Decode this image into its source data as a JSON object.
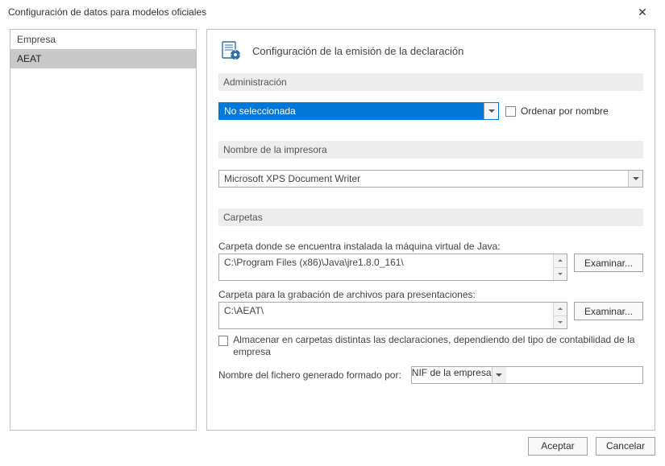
{
  "titlebar": {
    "title": "Configuración de datos para modelos oficiales"
  },
  "sidebar": {
    "items": [
      {
        "label": "Empresa",
        "selected": false
      },
      {
        "label": "AEAT",
        "selected": true
      }
    ]
  },
  "panel": {
    "title": "Configuración de la emisión de la declaración",
    "sections": {
      "admin": {
        "label": "Administración",
        "selected": "No seleccionada",
        "sort_label": "Ordenar por nombre",
        "sort_checked": false
      },
      "printer": {
        "label": "Nombre de la impresora",
        "value": "Microsoft XPS Document Writer"
      },
      "folders": {
        "label": "Carpetas",
        "java": {
          "label": "Carpeta donde se encuentra instalada la máquina virtual de Java:",
          "value": "C:\\Program Files (x86)\\Java\\jre1.8.0_161\\",
          "browse": "Examinar..."
        },
        "record": {
          "label": "Carpeta para la grabación de archivos para presentaciones:",
          "value": "C:\\AEAT\\",
          "browse": "Examinar..."
        },
        "split_folders": {
          "label": "Almacenar en carpetas distintas las declaraciones, dependiendo del tipo de contabilidad de la empresa",
          "checked": false
        },
        "filename": {
          "label": "Nombre del fichero generado formado por:",
          "value": "NIF de la empresa"
        }
      }
    }
  },
  "footer": {
    "ok": "Aceptar",
    "cancel": "Cancelar"
  }
}
